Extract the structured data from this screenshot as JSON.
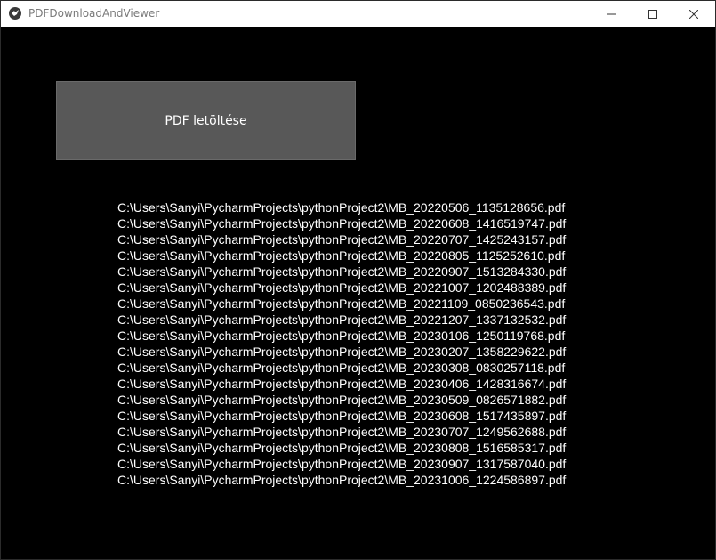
{
  "window": {
    "title": "PDFDownloadAndViewer"
  },
  "icons": {
    "app": "kivy-app-icon",
    "minimize": "minimize-icon",
    "maximize": "maximize-icon",
    "close": "close-icon"
  },
  "main": {
    "download_button_label": "PDF letöltése",
    "files": [
      "C:\\Users\\Sanyi\\PycharmProjects\\pythonProject2\\MB_20220506_1135128656.pdf",
      "C:\\Users\\Sanyi\\PycharmProjects\\pythonProject2\\MB_20220608_1416519747.pdf",
      "C:\\Users\\Sanyi\\PycharmProjects\\pythonProject2\\MB_20220707_1425243157.pdf",
      "C:\\Users\\Sanyi\\PycharmProjects\\pythonProject2\\MB_20220805_1125252610.pdf",
      "C:\\Users\\Sanyi\\PycharmProjects\\pythonProject2\\MB_20220907_1513284330.pdf",
      "C:\\Users\\Sanyi\\PycharmProjects\\pythonProject2\\MB_20221007_1202488389.pdf",
      "C:\\Users\\Sanyi\\PycharmProjects\\pythonProject2\\MB_20221109_0850236543.pdf",
      "C:\\Users\\Sanyi\\PycharmProjects\\pythonProject2\\MB_20221207_1337132532.pdf",
      "C:\\Users\\Sanyi\\PycharmProjects\\pythonProject2\\MB_20230106_1250119768.pdf",
      "C:\\Users\\Sanyi\\PycharmProjects\\pythonProject2\\MB_20230207_1358229622.pdf",
      "C:\\Users\\Sanyi\\PycharmProjects\\pythonProject2\\MB_20230308_0830257118.pdf",
      "C:\\Users\\Sanyi\\PycharmProjects\\pythonProject2\\MB_20230406_1428316674.pdf",
      "C:\\Users\\Sanyi\\PycharmProjects\\pythonProject2\\MB_20230509_0826571882.pdf",
      "C:\\Users\\Sanyi\\PycharmProjects\\pythonProject2\\MB_20230608_1517435897.pdf",
      "C:\\Users\\Sanyi\\PycharmProjects\\pythonProject2\\MB_20230707_1249562688.pdf",
      "C:\\Users\\Sanyi\\PycharmProjects\\pythonProject2\\MB_20230808_1516585317.pdf",
      "C:\\Users\\Sanyi\\PycharmProjects\\pythonProject2\\MB_20230907_1317587040.pdf",
      "C:\\Users\\Sanyi\\PycharmProjects\\pythonProject2\\MB_20231006_1224586897.pdf"
    ]
  },
  "colors": {
    "client_background": "#000000",
    "titlebar_background": "#ffffff",
    "button_background": "#585858",
    "text": "#ffffff"
  }
}
